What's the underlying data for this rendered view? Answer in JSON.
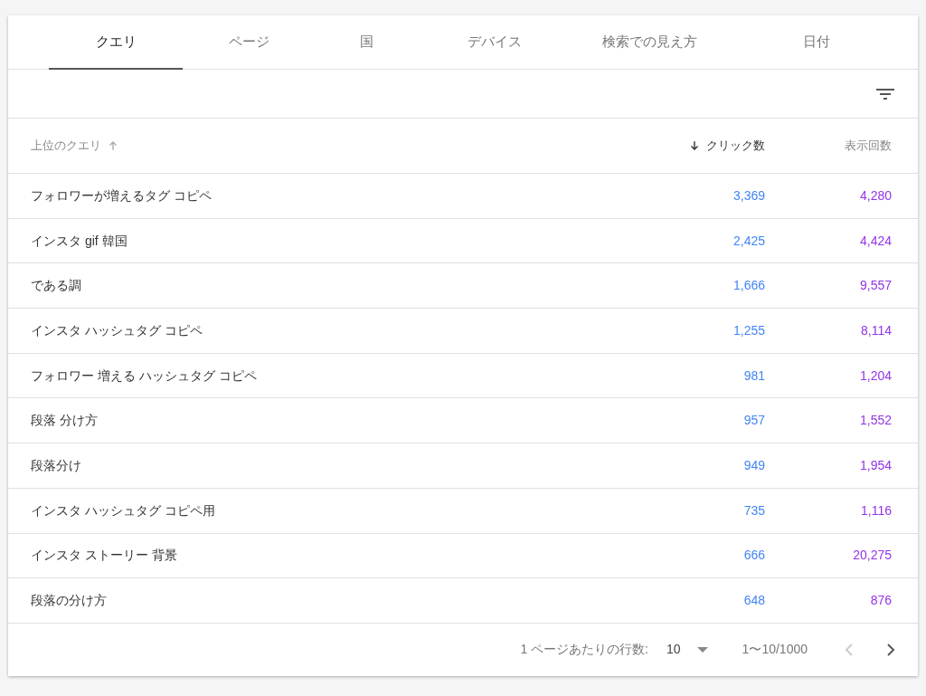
{
  "tabs": [
    {
      "label": "クエリ",
      "selected": true
    },
    {
      "label": "ページ",
      "selected": false
    },
    {
      "label": "国",
      "selected": false
    },
    {
      "label": "デバイス",
      "selected": false
    },
    {
      "label": "検索での見え方",
      "selected": false
    },
    {
      "label": "日付",
      "selected": false
    }
  ],
  "table": {
    "columns": [
      {
        "label": "上位のクエリ",
        "sort_arrow": true,
        "ascending": true,
        "sorted": false
      },
      {
        "label": "クリック数",
        "sort_arrow": true,
        "ascending": false,
        "sorted": true
      },
      {
        "label": "表示回数"
      }
    ],
    "rows": [
      {
        "query": "フォロワーが増えるタグ コピペ",
        "clicks": "3,369",
        "impressions": "4,280"
      },
      {
        "query": "インスタ gif 韓国",
        "clicks": "2,425",
        "impressions": "4,424"
      },
      {
        "query": "である調",
        "clicks": "1,666",
        "impressions": "9,557"
      },
      {
        "query": "インスタ ハッシュタグ コピペ",
        "clicks": "1,255",
        "impressions": "8,114"
      },
      {
        "query": "フォロワー 増える ハッシュタグ コピペ",
        "clicks": "981",
        "impressions": "1,204"
      },
      {
        "query": "段落 分け方",
        "clicks": "957",
        "impressions": "1,552"
      },
      {
        "query": "段落分け",
        "clicks": "949",
        "impressions": "1,954"
      },
      {
        "query": "インスタ ハッシュタグ コピペ用",
        "clicks": "735",
        "impressions": "1,116"
      },
      {
        "query": "インスタ ストーリー 背景",
        "clicks": "666",
        "impressions": "20,275"
      },
      {
        "query": "段落の分け方",
        "clicks": "648",
        "impressions": "876"
      }
    ]
  },
  "pagination": {
    "rows_per_page_label": "1 ページあたりの行数:",
    "rows_per_page": "10",
    "range": "1〜10/1000",
    "prev_disabled": true,
    "next_disabled": false
  }
}
